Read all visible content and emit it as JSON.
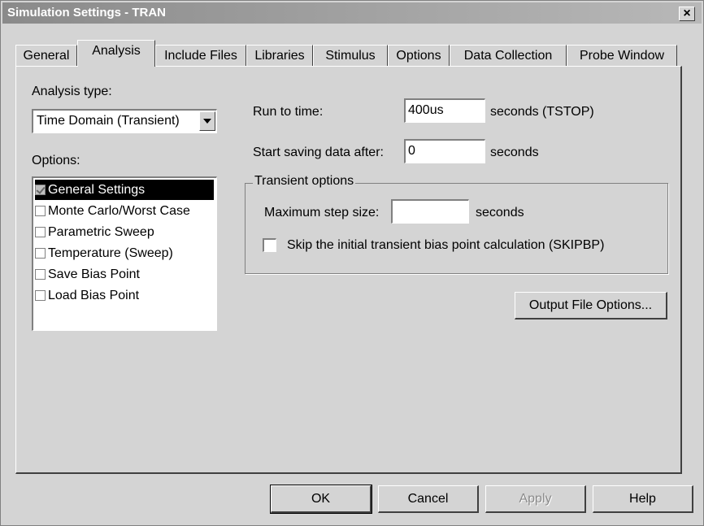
{
  "window": {
    "title": "Simulation Settings - TRAN",
    "close_label": "×"
  },
  "tabs": [
    {
      "label": "General"
    },
    {
      "label": "Analysis"
    },
    {
      "label": "Include Files"
    },
    {
      "label": "Libraries"
    },
    {
      "label": "Stimulus"
    },
    {
      "label": "Options"
    },
    {
      "label": "Data Collection"
    },
    {
      "label": "Probe Window"
    }
  ],
  "active_tab": "Analysis",
  "analysis": {
    "type_label": "Analysis type:",
    "type_value": "Time Domain (Transient)",
    "options_label": "Options:",
    "options": [
      {
        "label": "General Settings",
        "checked": true,
        "selected": true
      },
      {
        "label": "Monte Carlo/Worst Case",
        "checked": false,
        "selected": false
      },
      {
        "label": "Parametric Sweep",
        "checked": false,
        "selected": false
      },
      {
        "label": "Temperature (Sweep)",
        "checked": false,
        "selected": false
      },
      {
        "label": "Save Bias Point",
        "checked": false,
        "selected": false
      },
      {
        "label": "Load Bias Point",
        "checked": false,
        "selected": false
      }
    ]
  },
  "settings": {
    "run_to_time_label": "Run to time:",
    "run_to_time_value": "400us",
    "run_to_time_unit": "seconds  (TSTOP)",
    "start_saving_label": "Start saving data after:",
    "start_saving_value": "0",
    "start_saving_unit": "seconds",
    "transient_group_title": "Transient options",
    "max_step_label": "Maximum step size:",
    "max_step_value": "",
    "max_step_unit": "seconds",
    "skip_bias_label": "Skip the initial transient bias point calculation  (SKIPBP)",
    "skip_bias_checked": false,
    "output_file_options_label": "Output File Options..."
  },
  "buttons": {
    "ok": "OK",
    "cancel": "Cancel",
    "apply": "Apply",
    "help": "Help"
  }
}
